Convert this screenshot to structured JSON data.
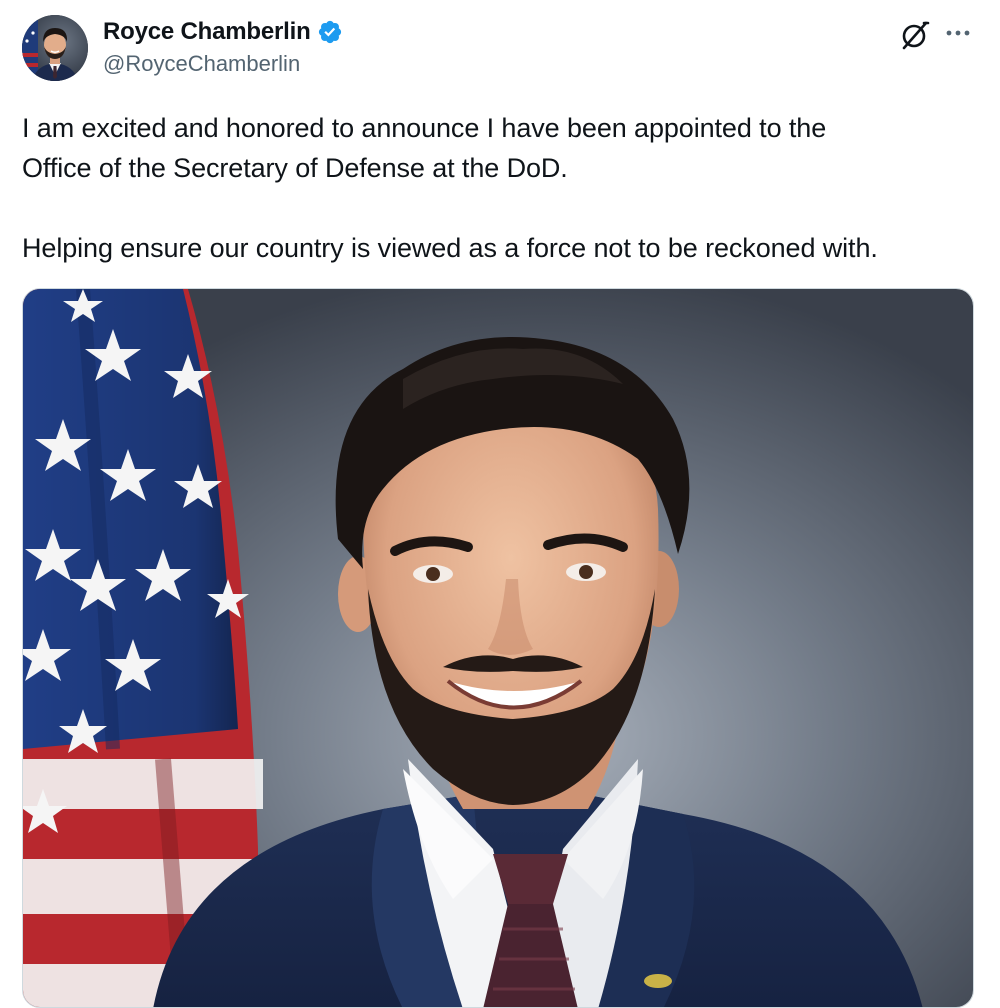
{
  "author": {
    "display_name": "Royce Chamberlin",
    "handle": "@RoyceChamberlin",
    "verified_icon": "verified-badge-icon",
    "avatar_icon": "avatar"
  },
  "actions": {
    "grok_icon": "grok-icon",
    "more_icon": "more-options-icon"
  },
  "tweet": {
    "paragraph1_line1": "I am excited and honored to announce I have been appointed to the",
    "paragraph1_line2": "Office of the Secretary of Defense at the DoD.",
    "paragraph2": "Helping ensure our country is viewed as a force not to be reckoned with."
  },
  "media": {
    "icon": "portrait-photo"
  },
  "colors": {
    "verified_blue": "#1d9bf0",
    "text": "#0f1419",
    "secondary_text": "#536471"
  }
}
